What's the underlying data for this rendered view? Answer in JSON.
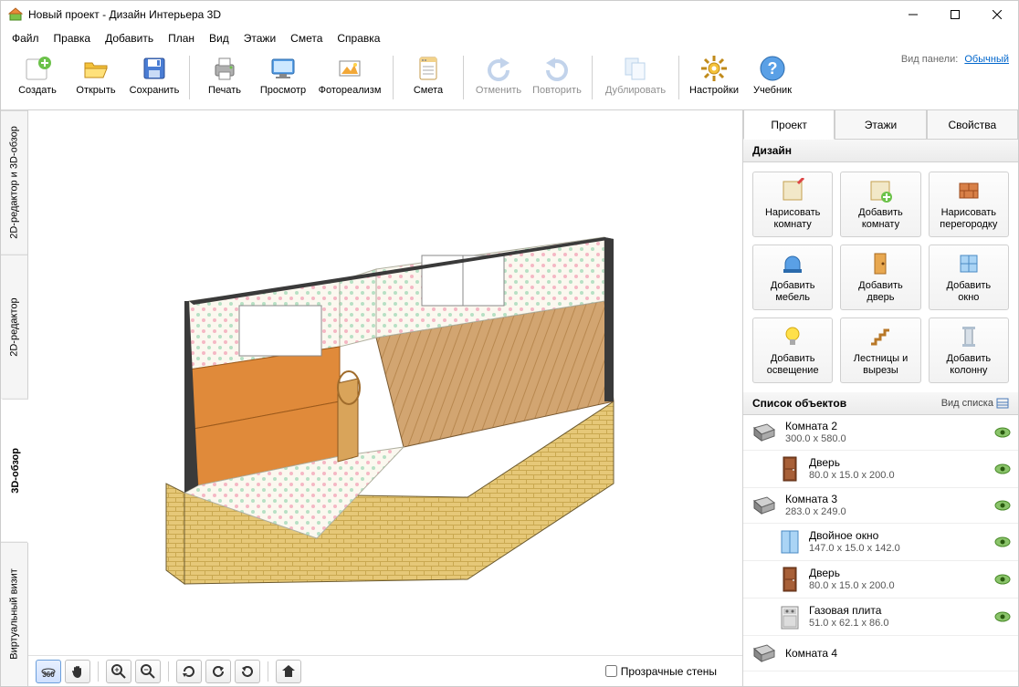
{
  "window": {
    "title": "Новый проект - Дизайн Интерьера 3D"
  },
  "menu": [
    "Файл",
    "Правка",
    "Добавить",
    "План",
    "Вид",
    "Этажи",
    "Смета",
    "Справка"
  ],
  "toolbar": [
    {
      "id": "create",
      "label": "Создать",
      "disabled": false
    },
    {
      "id": "open",
      "label": "Открыть",
      "disabled": false
    },
    {
      "id": "save",
      "label": "Сохранить",
      "disabled": false
    },
    {
      "sep": true
    },
    {
      "id": "print",
      "label": "Печать",
      "disabled": false
    },
    {
      "id": "preview",
      "label": "Просмотр",
      "disabled": false
    },
    {
      "id": "photoreal",
      "label": "Фотореализм",
      "disabled": false,
      "wide": true
    },
    {
      "sep": true
    },
    {
      "id": "estimate",
      "label": "Смета",
      "disabled": false
    },
    {
      "sep": true
    },
    {
      "id": "undo",
      "label": "Отменить",
      "disabled": true
    },
    {
      "id": "redo",
      "label": "Повторить",
      "disabled": true
    },
    {
      "sep": true
    },
    {
      "id": "duplicate",
      "label": "Дублировать",
      "disabled": true,
      "wide": true
    },
    {
      "sep": true
    },
    {
      "id": "settings",
      "label": "Настройки",
      "disabled": false
    },
    {
      "id": "help",
      "label": "Учебник",
      "disabled": false
    }
  ],
  "panel_info": {
    "label": "Вид панели:",
    "value": "Обычный"
  },
  "vtabs": [
    {
      "id": "2d3d",
      "label": "2D-редактор и 3D-обзор",
      "active": false
    },
    {
      "id": "2d",
      "label": "2D-редактор",
      "active": false
    },
    {
      "id": "3d",
      "label": "3D-обзор",
      "active": true
    },
    {
      "id": "virtual",
      "label": "Виртуальный визит",
      "active": false
    }
  ],
  "view_controls": {
    "buttons": [
      {
        "id": "orbit",
        "glyph": "360",
        "active": true,
        "type": "text"
      },
      {
        "id": "pan",
        "glyph": "hand",
        "active": false
      },
      {
        "sep": true
      },
      {
        "id": "zoom-in",
        "glyph": "+",
        "active": false,
        "type": "magnify"
      },
      {
        "id": "zoom-out",
        "glyph": "−",
        "active": false,
        "type": "magnify"
      },
      {
        "sep": true
      },
      {
        "id": "reset",
        "glyph": "reset",
        "active": false
      },
      {
        "id": "rot-left",
        "glyph": "rot-left",
        "active": false
      },
      {
        "id": "rot-right",
        "glyph": "rot-right",
        "active": false
      },
      {
        "sep": true
      },
      {
        "id": "home",
        "glyph": "home",
        "active": false
      }
    ],
    "transparent_walls_label": "Прозрачные стены",
    "transparent_walls_checked": false
  },
  "right_tabs": [
    {
      "id": "project",
      "label": "Проект",
      "active": true
    },
    {
      "id": "floors",
      "label": "Этажи",
      "active": false
    },
    {
      "id": "props",
      "label": "Свойства",
      "active": false
    }
  ],
  "design": {
    "header": "Дизайн",
    "items": [
      {
        "id": "draw-room",
        "label": "Нарисовать\nкомнату"
      },
      {
        "id": "add-room",
        "label": "Добавить\nкомнату"
      },
      {
        "id": "draw-wall",
        "label": "Нарисовать\nперегородку"
      },
      {
        "id": "add-furniture",
        "label": "Добавить\nмебель"
      },
      {
        "id": "add-door",
        "label": "Добавить\nдверь"
      },
      {
        "id": "add-window",
        "label": "Добавить\nокно"
      },
      {
        "id": "add-light",
        "label": "Добавить\nосвещение"
      },
      {
        "id": "stairs",
        "label": "Лестницы и\nвырезы"
      },
      {
        "id": "add-column",
        "label": "Добавить\nколонну"
      }
    ]
  },
  "objects": {
    "header": "Список объектов",
    "view_mode_label": "Вид списка",
    "items": [
      {
        "type": "room",
        "name": "Комната 2",
        "dim": "300.0 x 580.0"
      },
      {
        "type": "door",
        "name": "Дверь",
        "dim": "80.0 x 15.0 x 200.0",
        "child": true
      },
      {
        "type": "room",
        "name": "Комната 3",
        "dim": "283.0 x 249.0"
      },
      {
        "type": "window",
        "name": "Двойное окно",
        "dim": "147.0 x 15.0 x 142.0",
        "child": true
      },
      {
        "type": "door",
        "name": "Дверь",
        "dim": "80.0 x 15.0 x 200.0",
        "child": true
      },
      {
        "type": "stove",
        "name": "Газовая плита",
        "dim": "51.0 x 62.1 x 86.0",
        "child": true
      },
      {
        "type": "room",
        "name": "Комната 4",
        "dim": "",
        "partial": true
      }
    ]
  }
}
